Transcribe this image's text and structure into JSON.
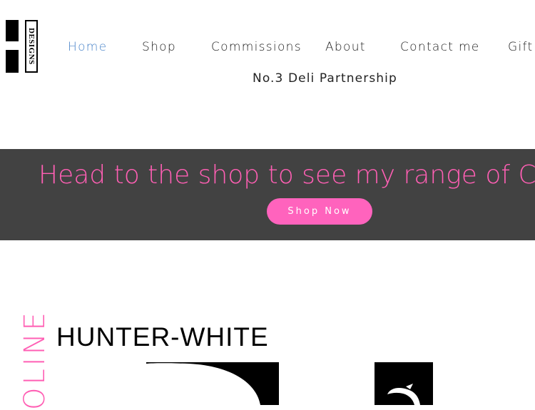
{
  "logo": {
    "text": "DESIGNS"
  },
  "nav": {
    "items": [
      {
        "label": "Home"
      },
      {
        "label": "Shop"
      },
      {
        "label": "Commissions"
      },
      {
        "label": "About"
      },
      {
        "label": "Contact me"
      },
      {
        "label": "Gift"
      }
    ],
    "second_row": "No.3 Deli Partnership"
  },
  "banner": {
    "headline": "Head to the shop to see my range of Christmas",
    "cta_label": "Shop Now"
  },
  "brand": {
    "vertical_word": "OLINE",
    "name": "HUNTER-WHITE"
  },
  "colors": {
    "accent_pink": "#ff5fb4",
    "banner_bg": "#424242",
    "nav_active": "#4a84c9"
  }
}
